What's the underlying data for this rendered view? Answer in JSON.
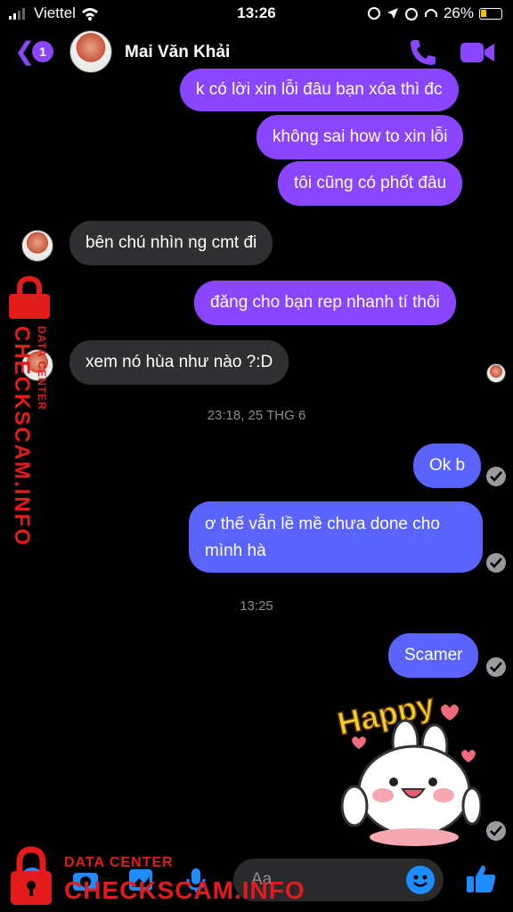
{
  "status_bar": {
    "carrier": "Viettel",
    "time": "13:26",
    "battery": "26%"
  },
  "header": {
    "unread_count": "1",
    "contact_name": "Mai Văn Khải"
  },
  "messages": [
    {
      "text": "k có lời xin lỗi đâu bạn xóa thì đc"
    },
    {
      "text": "không sai how to xin lỗi"
    },
    {
      "text": "tôi cũng có phốt đâu"
    },
    {
      "text": "bên chú nhìn ng cmt đi"
    },
    {
      "text": "đăng cho bạn rep nhanh tí thôi"
    },
    {
      "text": "xem nó hùa như nào ?:D"
    },
    {
      "text": "Ok b"
    },
    {
      "text": "ơ thế vẫn lề mề chưa done cho"
    },
    {
      "text": "mình hà"
    },
    {
      "text": "Scamer"
    }
  ],
  "timestamps": [
    "23:18, 25 THG 6",
    "13:25"
  ],
  "sticker_text": "Happy",
  "composer": {
    "placeholder": "Aa"
  },
  "watermark": {
    "small": "DATA CENTER",
    "big": "CHECKSCAM.INFO"
  },
  "colors": {
    "accent": "#8a45ff",
    "outgoing_blue": "#5b63ff",
    "incoming": "#303033",
    "watermark": "#e41b1b"
  }
}
